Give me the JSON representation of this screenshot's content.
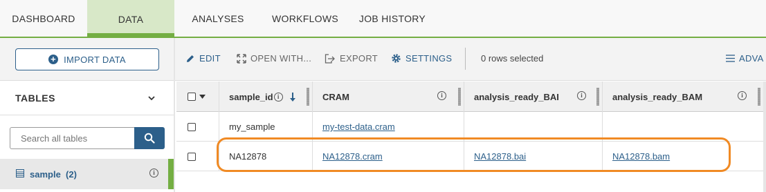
{
  "topnav": {
    "tabs": [
      {
        "label": "DASHBOARD"
      },
      {
        "label": "DATA"
      },
      {
        "label": "ANALYSES"
      },
      {
        "label": "WORKFLOWS"
      },
      {
        "label": "JOB HISTORY"
      }
    ],
    "active_tab": "DATA",
    "accent_color": "#74ae43"
  },
  "sidebar": {
    "import_label": "IMPORT DATA",
    "tables_title": "TABLES",
    "search_placeholder": "Search all tables",
    "tables": [
      {
        "name": "sample",
        "count": "(2)"
      }
    ]
  },
  "toolbar": {
    "edit_label": "EDIT",
    "open_with_label": "OPEN WITH...",
    "export_label": "EXPORT",
    "settings_label": "SETTINGS",
    "rows_selected": "0 rows selected",
    "advanced_label": "ADVA"
  },
  "grid": {
    "columns": [
      "sample_id",
      "CRAM",
      "analysis_ready_BAI",
      "analysis_ready_BAM"
    ],
    "sort_column": "sample_id",
    "sort_direction": "descending",
    "rows": [
      {
        "sample_id": "my_sample",
        "CRAM": "my-test-data.cram",
        "analysis_ready_BAI": "",
        "analysis_ready_BAM": ""
      },
      {
        "sample_id": "NA12878",
        "CRAM": "NA12878.cram",
        "analysis_ready_BAI": "NA12878.bai",
        "analysis_ready_BAM": "NA12878.bam"
      }
    ]
  },
  "highlight_color": "#f08a24",
  "link_color": "#2c5f8a"
}
